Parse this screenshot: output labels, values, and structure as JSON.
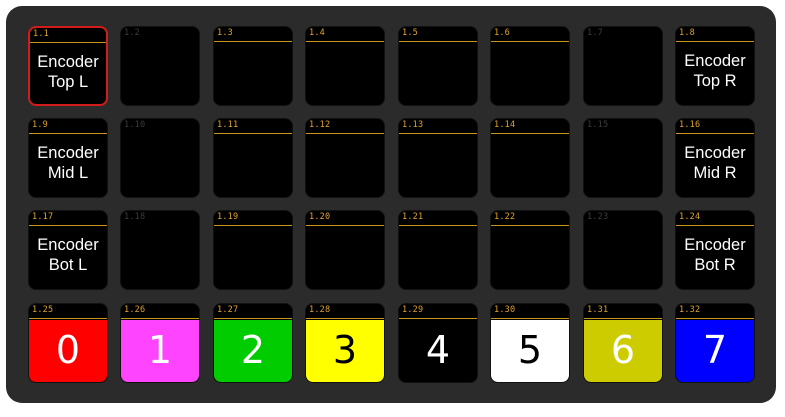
{
  "buttons": [
    {
      "id": "1.1",
      "label": "Encoder\nTop L",
      "selected": true
    },
    {
      "id": "1.2",
      "dim": true
    },
    {
      "id": "1.3"
    },
    {
      "id": "1.4"
    },
    {
      "id": "1.5"
    },
    {
      "id": "1.6"
    },
    {
      "id": "1.7",
      "dim": true
    },
    {
      "id": "1.8",
      "label": "Encoder\nTop R"
    },
    {
      "id": "1.9",
      "label": "Encoder\nMid L"
    },
    {
      "id": "1.10",
      "dim": true
    },
    {
      "id": "1.11"
    },
    {
      "id": "1.12"
    },
    {
      "id": "1.13"
    },
    {
      "id": "1.14"
    },
    {
      "id": "1.15",
      "dim": true
    },
    {
      "id": "1.16",
      "label": "Encoder\nMid R"
    },
    {
      "id": "1.17",
      "label": "Encoder\nBot L"
    },
    {
      "id": "1.18",
      "dim": true
    },
    {
      "id": "1.19"
    },
    {
      "id": "1.20"
    },
    {
      "id": "1.21"
    },
    {
      "id": "1.22"
    },
    {
      "id": "1.23",
      "dim": true
    },
    {
      "id": "1.24",
      "label": "Encoder\nBot R"
    },
    {
      "id": "1.25",
      "digit": "0",
      "bg": "#ff0000",
      "fg": "#ffffff"
    },
    {
      "id": "1.26",
      "digit": "1",
      "bg": "#ff44ff",
      "fg": "#ffffff"
    },
    {
      "id": "1.27",
      "digit": "2",
      "bg": "#00cc00",
      "fg": "#ffffff"
    },
    {
      "id": "1.28",
      "digit": "3",
      "bg": "#ffff00",
      "fg": "#000000"
    },
    {
      "id": "1.29",
      "digit": "4",
      "bg": "#000000",
      "fg": "#ffffff"
    },
    {
      "id": "1.30",
      "digit": "5",
      "bg": "#ffffff",
      "fg": "#000000"
    },
    {
      "id": "1.31",
      "digit": "6",
      "bg": "#cccc00",
      "fg": "#ffffff"
    },
    {
      "id": "1.32",
      "digit": "7",
      "bg": "#0000ff",
      "fg": "#ffffff"
    }
  ]
}
